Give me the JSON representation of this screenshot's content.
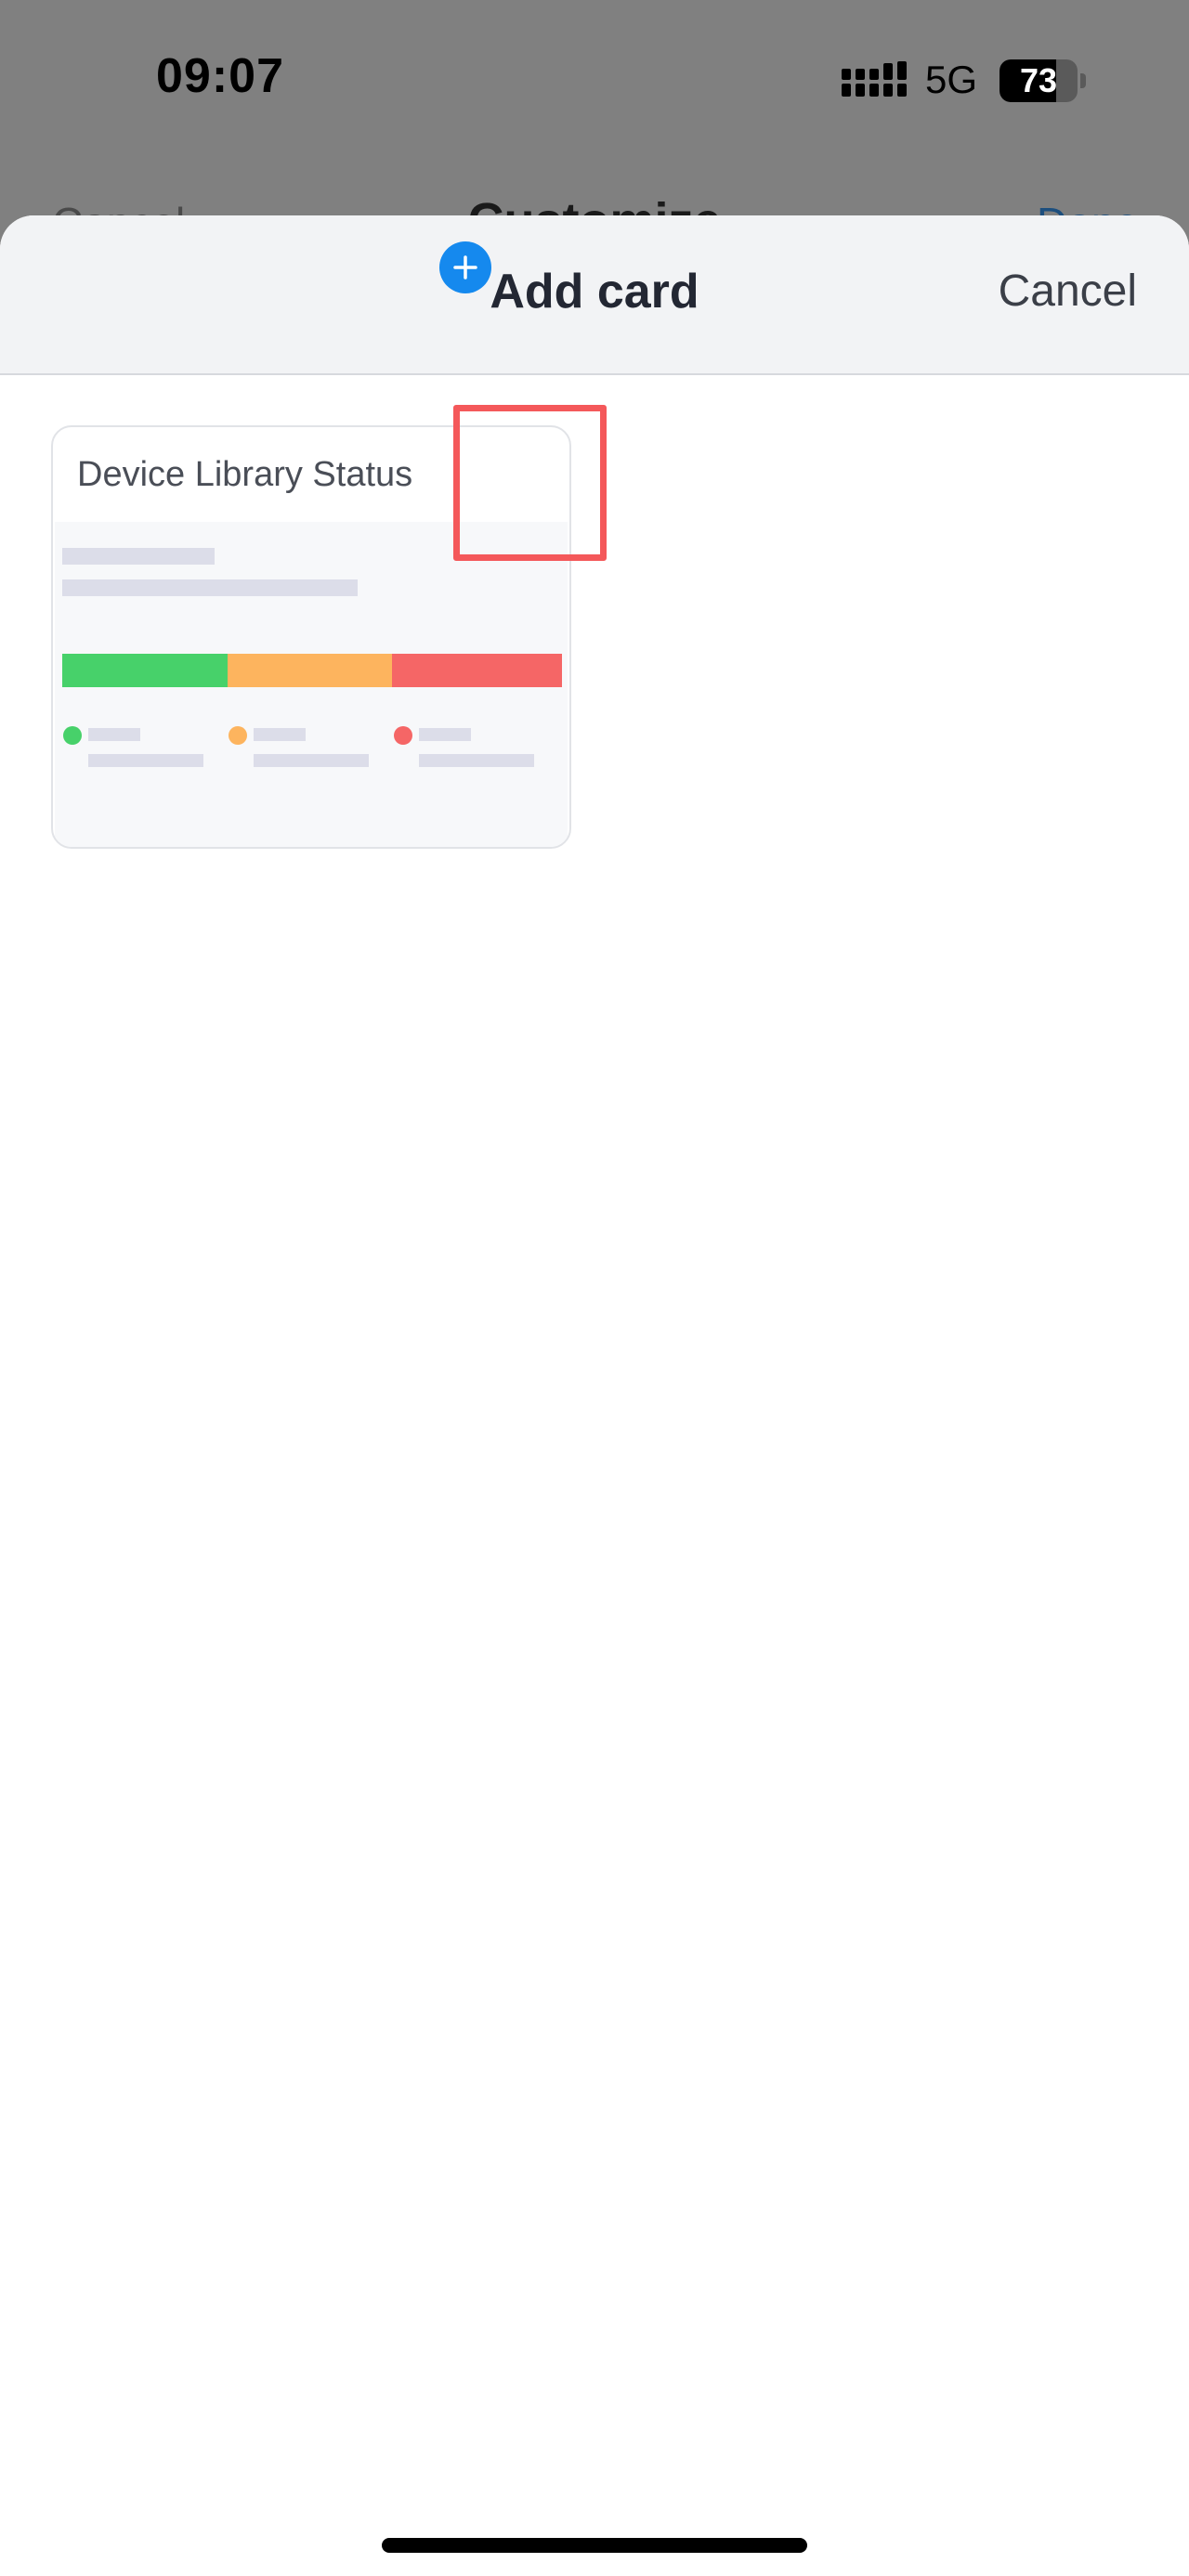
{
  "status_bar": {
    "time": "09:07",
    "network": "5G",
    "battery": "73",
    "battery_fraction": 0.73,
    "signal_icon": "signal-bars-icon",
    "battery_icon": "battery-icon"
  },
  "background_page": {
    "cancel_label": "Cancel",
    "title": "Customize",
    "done_label": "Done"
  },
  "sheet": {
    "title": "Add card",
    "cancel_label": "Cancel"
  },
  "cards": [
    {
      "title": "Device Library Status",
      "add_icon": "plus-circle-icon",
      "segments": [
        {
          "color": "#47d16a",
          "share": 0.33
        },
        {
          "color": "#fdb45e",
          "share": 0.33
        },
        {
          "color": "#f56666",
          "share": 0.34
        }
      ]
    }
  ],
  "colors": {
    "accent": "#1589ee",
    "highlight": "#f4585a",
    "green": "#47d16a",
    "orange": "#fdb45e",
    "red": "#f56666"
  }
}
